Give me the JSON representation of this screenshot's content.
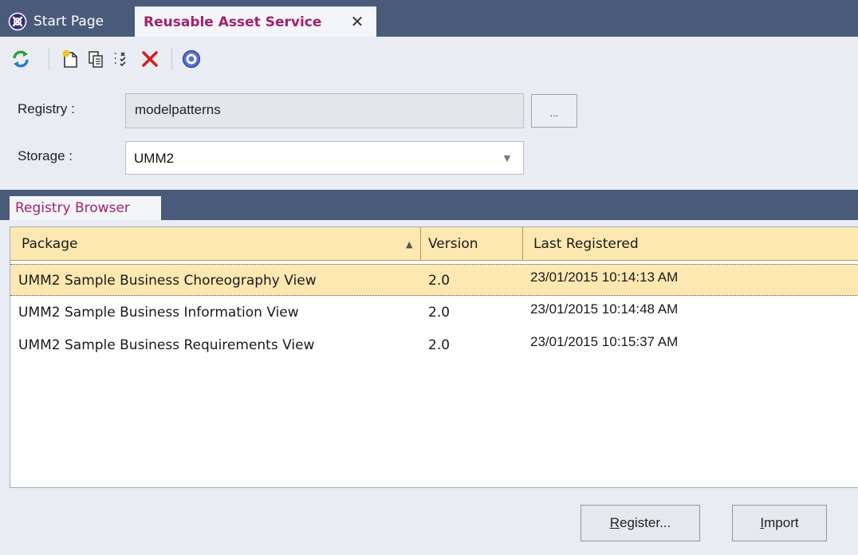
{
  "tabs": {
    "start_page": "Start Page",
    "active": "Reusable Asset Service",
    "close_symbol": "✕"
  },
  "toolbar": {
    "icons": [
      "refresh-icon",
      "new-document-icon",
      "copy-icon",
      "checklist-icon",
      "delete-icon",
      "help-icon"
    ],
    "delete_color": "#d42020"
  },
  "form": {
    "registry_label": "Registry :",
    "registry_value": "modelpatterns",
    "browse_label": "...",
    "storage_label": "Storage :",
    "storage_value": "UMM2"
  },
  "subtab": {
    "label": "Registry Browser"
  },
  "grid": {
    "columns": [
      "Package",
      "Version",
      "Last Registered"
    ],
    "sorted_column": "Package",
    "rows": [
      {
        "package": "UMM2 Sample Business Choreography View",
        "version": "2.0",
        "registered": "23/01/2015 10:14:13 AM",
        "selected": true
      },
      {
        "package": "UMM2 Sample Business Information View",
        "version": "2.0",
        "registered": "23/01/2015 10:14:48 AM",
        "selected": false
      },
      {
        "package": "UMM2 Sample Business Requirements View",
        "version": "2.0",
        "registered": "23/01/2015 10:15:37 AM",
        "selected": false
      }
    ]
  },
  "buttons": {
    "register_prefix": "R",
    "register_rest": "egister...",
    "import_prefix": "I",
    "import_rest": "mport"
  },
  "colors": {
    "tabbar": "#4a5a7a",
    "accent_text": "#a1236b",
    "selection": "#fde8b2"
  }
}
